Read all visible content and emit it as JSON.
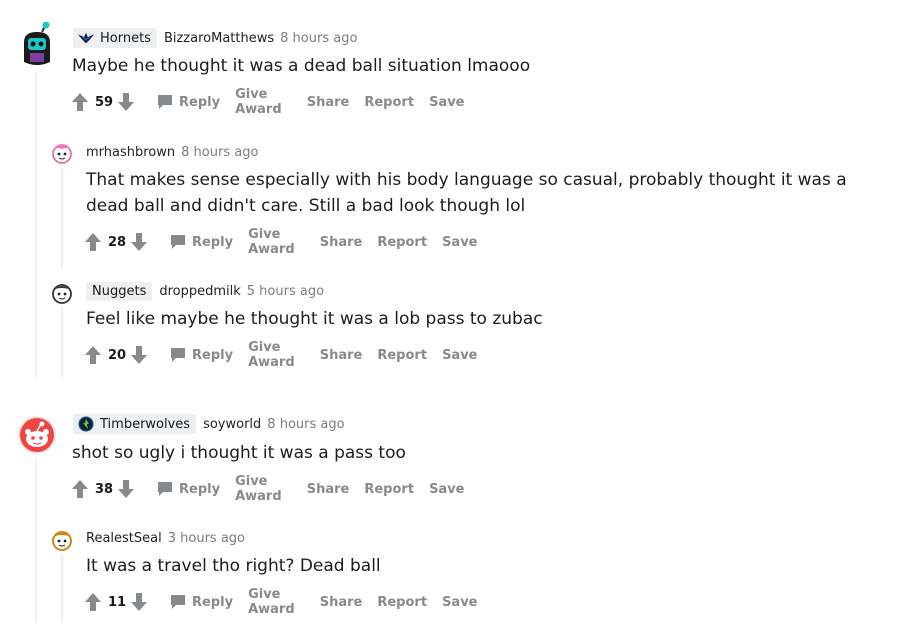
{
  "comments": [
    {
      "flair": "Hornets",
      "author": "BizzaroMatthews",
      "time": "8 hours ago",
      "text": "Maybe he thought it was a dead ball situation lmaooo",
      "score": "59",
      "actions": [
        "Reply",
        "Give Award",
        "Share",
        "Report",
        "Save"
      ]
    },
    {
      "author": "mrhashbrown",
      "time": "8 hours ago",
      "text": "That makes sense especially with his body language so casual, probably thought it was a dead ball and didn't care. Still a bad look though lol",
      "score": "28",
      "actions": [
        "Reply",
        "Give Award",
        "Share",
        "Report",
        "Save"
      ]
    },
    {
      "flair": "Nuggets",
      "author": "droppedmilk",
      "time": "5 hours ago",
      "text": "Feel like maybe he thought it was a lob pass to zubac",
      "score": "20",
      "actions": [
        "Reply",
        "Give Award",
        "Share",
        "Report",
        "Save"
      ]
    },
    {
      "flair": "Timberwolves",
      "author": "soyworld",
      "time": "8 hours ago",
      "text": "shot so ugly i thought it was a pass too",
      "score": "38",
      "actions": [
        "Reply",
        "Give Award",
        "Share",
        "Report",
        "Save"
      ]
    },
    {
      "author": "RealestSeal",
      "time": "3 hours ago",
      "text": "It was a travel tho right? Dead ball",
      "score": "11",
      "actions": [
        "Reply",
        "Give Award",
        "Share",
        "Report",
        "Save"
      ]
    }
  ],
  "colors": {
    "meta_gray": "#878a8c",
    "flair_bg": "#edeff1",
    "thread_line": "#edeff1"
  }
}
